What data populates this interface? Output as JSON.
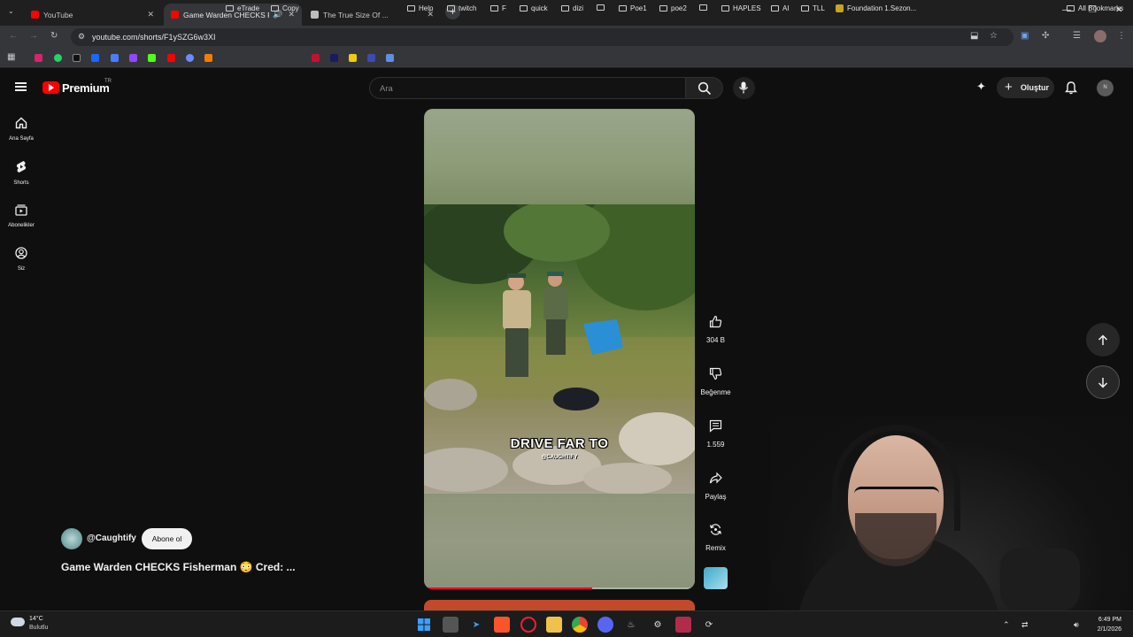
{
  "browser": {
    "tabs": [
      {
        "title": "YouTube",
        "fav_color": "#ff0000",
        "active": false
      },
      {
        "title": "Game Warden CHECKS Fish",
        "fav_color": "#ff0000",
        "active": true
      },
      {
        "title": "The True Size Of ...",
        "fav_color": "#bdbdbd",
        "active": false
      }
    ],
    "url": "youtube.com/shorts/F1ySZG6w3XI",
    "bookmarks": [
      "eTrade",
      "Copy",
      "Help",
      "twitch",
      "F",
      "quick",
      "dizi",
      "Poe1",
      "poe2",
      "HAPLES",
      "AI",
      "TLL",
      "Foundation 1.Sezon...",
      "All Bookmarks"
    ]
  },
  "youtube": {
    "brand": "Premium",
    "country": "TR",
    "search_placeholder": "Ara",
    "create_label": "Oluştur",
    "avatar_initial": "N",
    "nav": [
      {
        "label": "Ana Sayfa",
        "icon": "home-icon"
      },
      {
        "label": "Shorts",
        "icon": "shorts-icon"
      },
      {
        "label": "Abonelikler",
        "icon": "subscriptions-icon"
      },
      {
        "label": "Siz",
        "icon": "you-icon"
      }
    ]
  },
  "short": {
    "caption": "DRIVE FAR TO",
    "watermark": "@CAUGHTIFY",
    "progress": 0.62,
    "channel": "@Caughtify",
    "subscribe_label": "Abone ol",
    "title": "Game Warden CHECKS Fisherman 😳 Cred: ...",
    "actions": {
      "likes": "304 B",
      "dislike_label": "Beğenme",
      "comments": "1.559",
      "share_label": "Paylaş",
      "remix_label": "Remix"
    }
  },
  "taskbar": {
    "temperature": "14°C",
    "condition": "Bulutlu",
    "time": "6:49 PM",
    "date": "2/1/2026"
  }
}
